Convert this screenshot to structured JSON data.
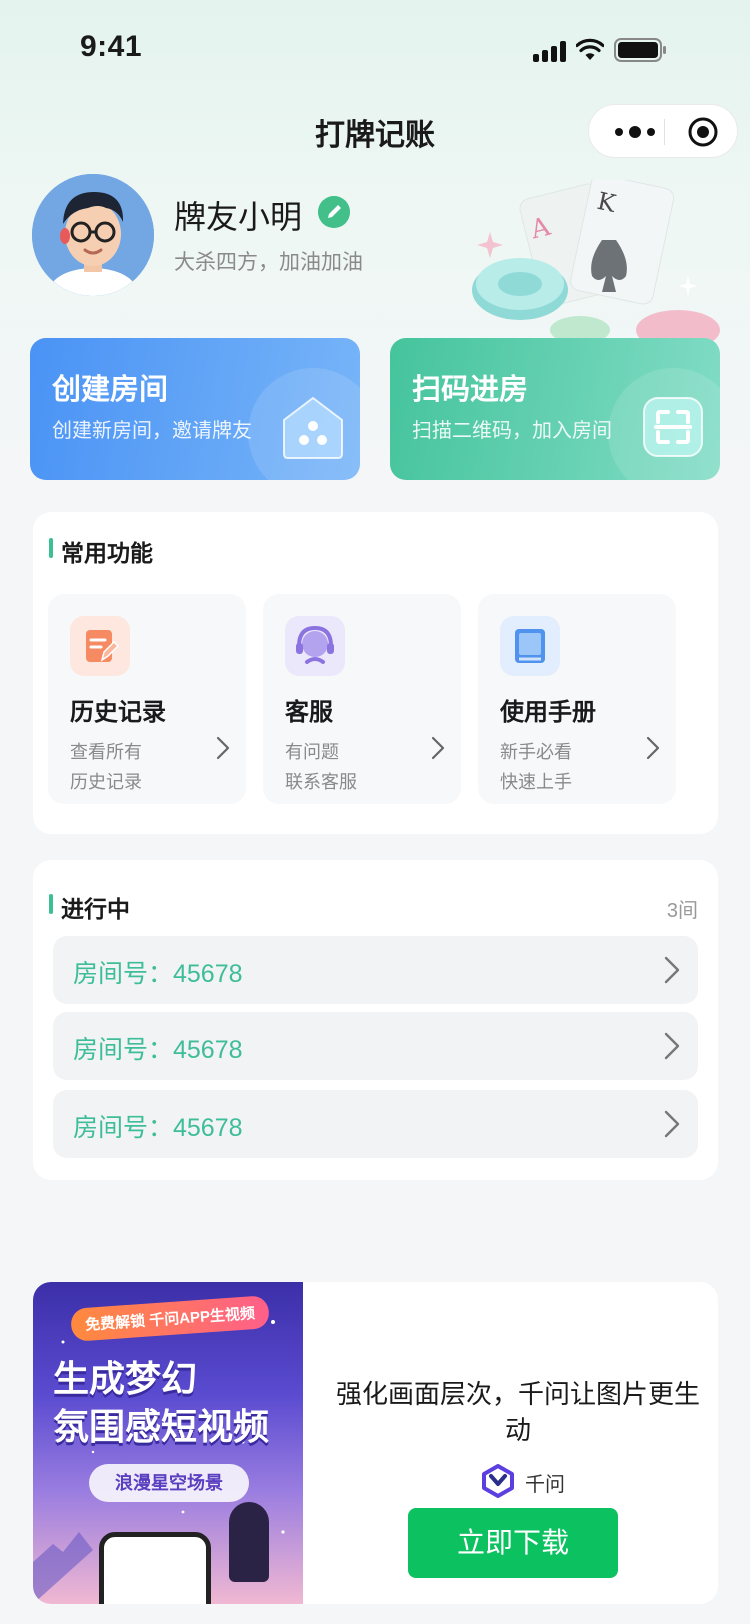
{
  "status_bar": {
    "time": "9:41"
  },
  "nav": {
    "title": "打牌记账"
  },
  "profile": {
    "nickname": "牌友小明",
    "signature": "大杀四方，加油加油"
  },
  "actions": [
    {
      "title": "创建房间",
      "desc": "创建新房间，邀请牌友"
    },
    {
      "title": "扫码进房",
      "desc": "扫描二维码，加入房间"
    }
  ],
  "common": {
    "title": "常用功能",
    "items": [
      {
        "name": "历史记录",
        "desc1": "查看所有",
        "desc2": "历史记录",
        "icon": "history-icon"
      },
      {
        "name": "客服",
        "desc1": "有问题",
        "desc2": "联系客服",
        "icon": "customer-service-icon"
      },
      {
        "name": "使用手册",
        "desc1": "新手必看",
        "desc2": "快速上手",
        "icon": "manual-icon"
      }
    ]
  },
  "active": {
    "title": "进行中",
    "count": "3间",
    "rooms": [
      {
        "label": "房间号：45678"
      },
      {
        "label": "房间号：45678"
      },
      {
        "label": "房间号：45678"
      }
    ]
  },
  "ad": {
    "image_tag": "免费解锁 千问APP生视频",
    "image_headline1": "生成梦幻",
    "image_headline2": "氛围感短视频",
    "image_chip": "浪漫星空场景",
    "text": "强化画面层次，千问让图片更生动",
    "brand": "千问",
    "button": "立即下载"
  },
  "colors": {
    "accent_green": "#3cbf93",
    "create_blue": "#4a93f5",
    "download_green": "#0cc160"
  }
}
